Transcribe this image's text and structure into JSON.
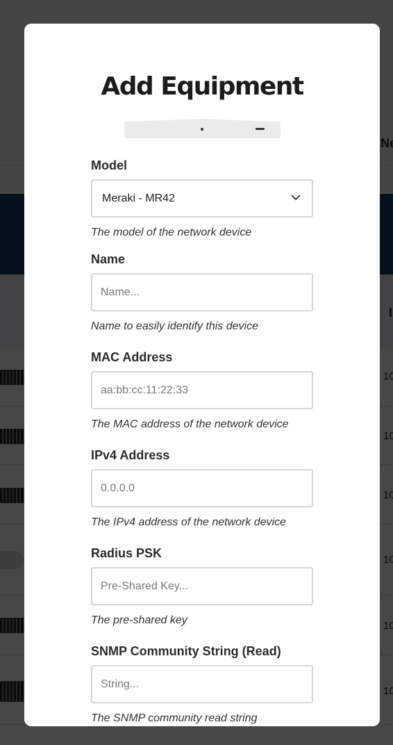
{
  "background": {
    "column_header_1": "Ne",
    "column_header_2": "I",
    "row_value": "10"
  },
  "modal": {
    "title": "Add Equipment",
    "device_image": "meraki-mr42-access-point",
    "fields": {
      "model": {
        "label": "Model",
        "value": "Meraki - MR42",
        "help": "The model of the network device"
      },
      "name": {
        "label": "Name",
        "value": "",
        "placeholder": "Name...",
        "help": "Name to easily identify this device"
      },
      "mac": {
        "label": "MAC Address",
        "value": "",
        "placeholder": "aa:bb:cc:11:22:33",
        "help": "The MAC address of the network device"
      },
      "ipv4": {
        "label": "IPv4 Address",
        "value": "",
        "placeholder": "0.0.0.0",
        "help": "The IPv4 address of the network device"
      },
      "radius_psk": {
        "label": "Radius PSK",
        "value": "",
        "placeholder": "Pre-Shared Key...",
        "help": "The pre-shared key"
      },
      "snmp_read": {
        "label": "SNMP Community String (Read)",
        "value": "",
        "placeholder": "String...",
        "help": "The SNMP community read string"
      }
    }
  },
  "colors": {
    "overlay": "#000000",
    "modal_background": "#ffffff",
    "input_border": "#d6d6d6",
    "title": "#1c1c1c",
    "banner": "#0f3a63"
  }
}
